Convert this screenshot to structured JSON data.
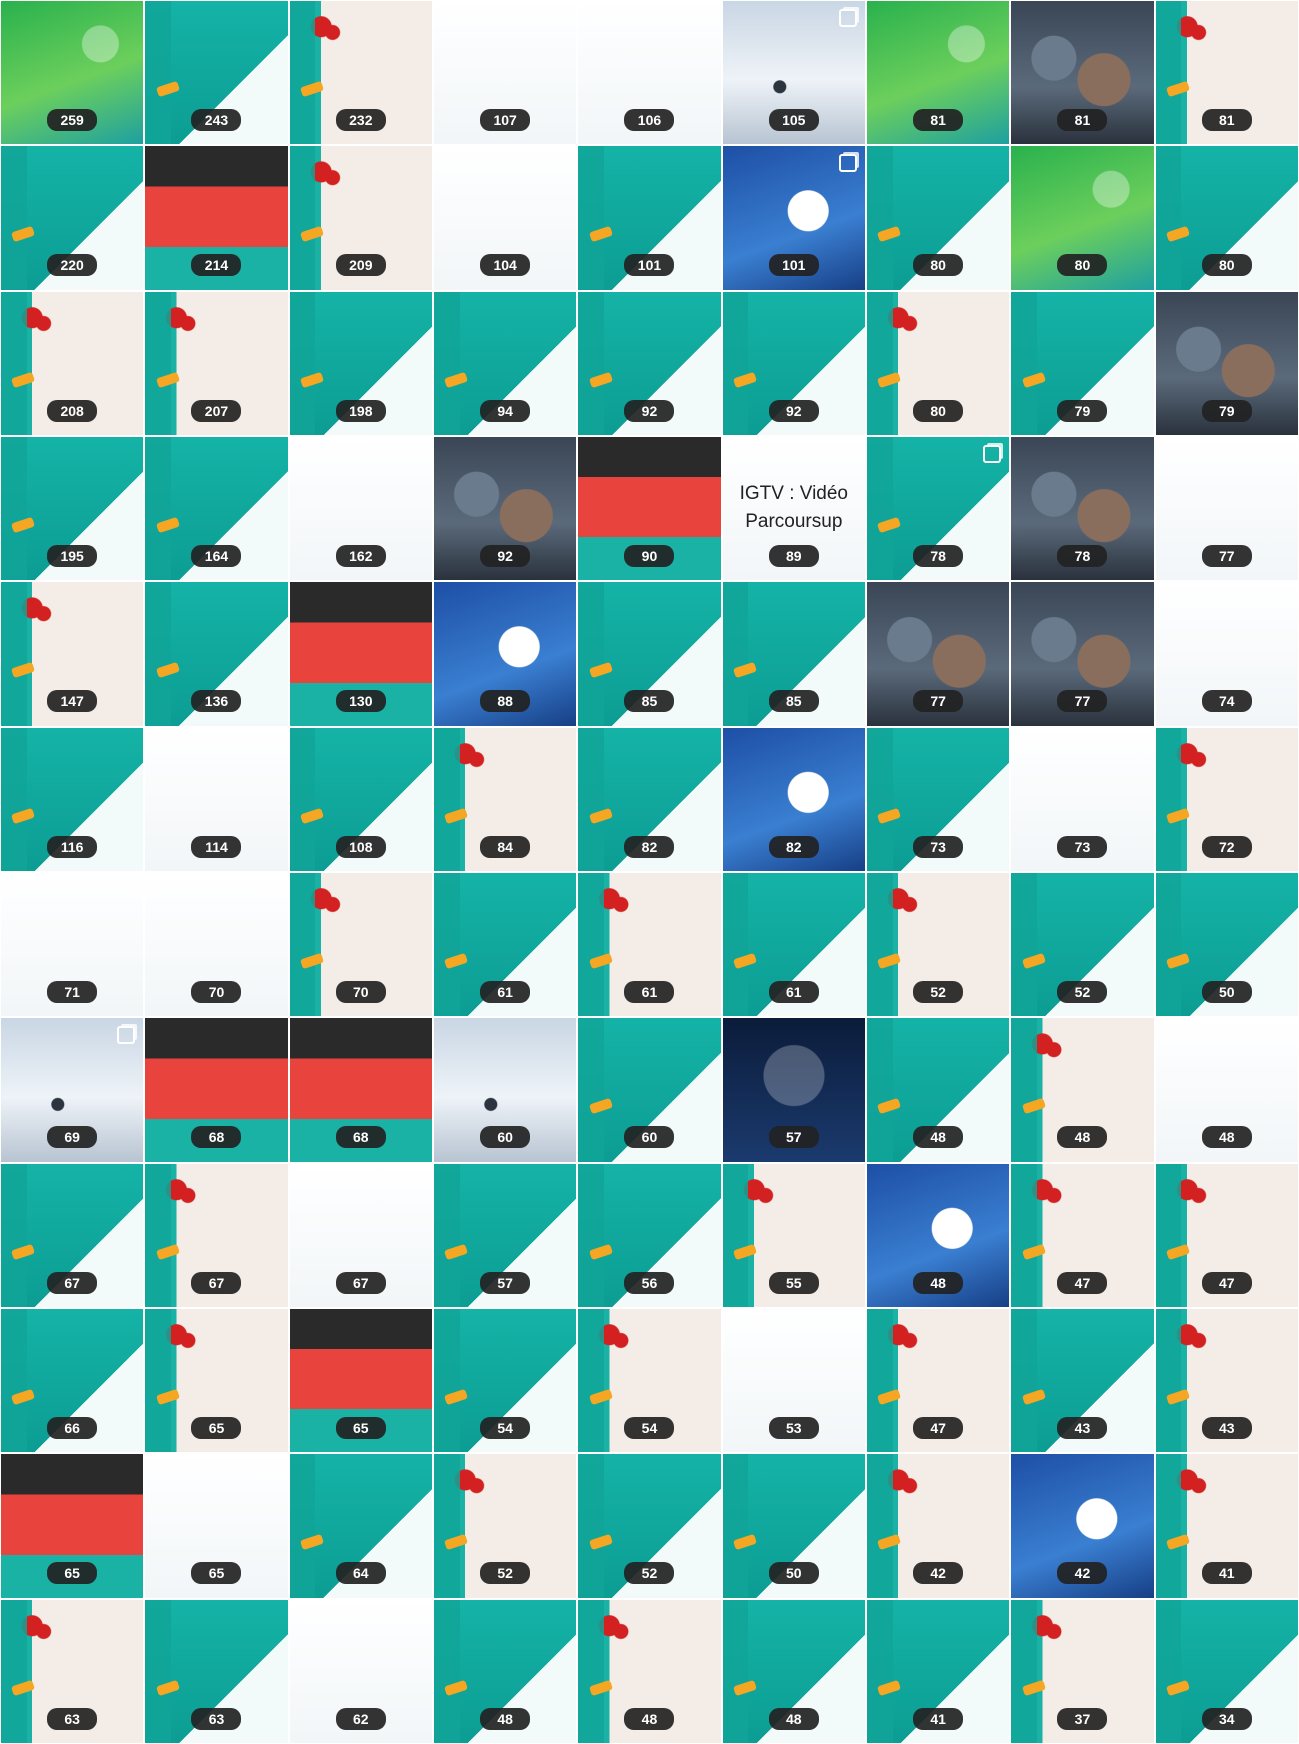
{
  "grid": {
    "columns": 9,
    "tiles": [
      {
        "count": "259",
        "style": "green"
      },
      {
        "count": "243",
        "style": "teal"
      },
      {
        "count": "232",
        "style": "xmas"
      },
      {
        "count": "107",
        "style": "white"
      },
      {
        "count": "106",
        "style": "white"
      },
      {
        "count": "105",
        "style": "snow"
      },
      {
        "count": "81",
        "style": "green"
      },
      {
        "count": "81",
        "style": "photo"
      },
      {
        "count": "81",
        "style": "xmas"
      },
      {
        "count": "220",
        "style": "teal"
      },
      {
        "count": "214",
        "style": "red"
      },
      {
        "count": "209",
        "style": "xmas"
      },
      {
        "count": "104",
        "style": "white"
      },
      {
        "count": "101",
        "style": "teal"
      },
      {
        "count": "101",
        "style": "blue"
      },
      {
        "count": "80",
        "style": "teal"
      },
      {
        "count": "80",
        "style": "green"
      },
      {
        "count": "80",
        "style": "teal"
      },
      {
        "count": "208",
        "style": "xmas"
      },
      {
        "count": "207",
        "style": "xmas"
      },
      {
        "count": "198",
        "style": "teal"
      },
      {
        "count": "94",
        "style": "teal"
      },
      {
        "count": "92",
        "style": "teal"
      },
      {
        "count": "92",
        "style": "teal"
      },
      {
        "count": "80",
        "style": "xmas"
      },
      {
        "count": "79",
        "style": "teal"
      },
      {
        "count": "79",
        "style": "photo"
      },
      {
        "count": "195",
        "style": "teal"
      },
      {
        "count": "164",
        "style": "teal"
      },
      {
        "count": "162",
        "style": "white"
      },
      {
        "count": "92",
        "style": "photo"
      },
      {
        "count": "90",
        "style": "red"
      },
      {
        "count": "89",
        "style": "white",
        "label": "IGTV : Vidéo\nParcoursup"
      },
      {
        "count": "78",
        "style": "teal"
      },
      {
        "count": "78",
        "style": "photo"
      },
      {
        "count": "77",
        "style": "white"
      },
      {
        "count": "147",
        "style": "xmas"
      },
      {
        "count": "136",
        "style": "teal"
      },
      {
        "count": "130",
        "style": "red"
      },
      {
        "count": "88",
        "style": "blue"
      },
      {
        "count": "85",
        "style": "teal"
      },
      {
        "count": "85",
        "style": "teal"
      },
      {
        "count": "77",
        "style": "photo"
      },
      {
        "count": "77",
        "style": "photo"
      },
      {
        "count": "74",
        "style": "white"
      },
      {
        "count": "116",
        "style": "teal"
      },
      {
        "count": "114",
        "style": "white"
      },
      {
        "count": "108",
        "style": "teal"
      },
      {
        "count": "84",
        "style": "xmas"
      },
      {
        "count": "82",
        "style": "teal"
      },
      {
        "count": "82",
        "style": "blue"
      },
      {
        "count": "73",
        "style": "teal"
      },
      {
        "count": "73",
        "style": "white"
      },
      {
        "count": "72",
        "style": "xmas"
      },
      {
        "count": "71",
        "style": "white"
      },
      {
        "count": "70",
        "style": "white"
      },
      {
        "count": "70",
        "style": "xmas"
      },
      {
        "count": "61",
        "style": "teal"
      },
      {
        "count": "61",
        "style": "xmas"
      },
      {
        "count": "61",
        "style": "teal"
      },
      {
        "count": "52",
        "style": "xmas"
      },
      {
        "count": "52",
        "style": "teal"
      },
      {
        "count": "50",
        "style": "teal"
      },
      {
        "count": "69",
        "style": "snow"
      },
      {
        "count": "68",
        "style": "red"
      },
      {
        "count": "68",
        "style": "red"
      },
      {
        "count": "60",
        "style": "snow"
      },
      {
        "count": "60",
        "style": "teal"
      },
      {
        "count": "57",
        "style": "dark"
      },
      {
        "count": "48",
        "style": "teal"
      },
      {
        "count": "48",
        "style": "xmas"
      },
      {
        "count": "48",
        "style": "white"
      },
      {
        "count": "67",
        "style": "teal"
      },
      {
        "count": "67",
        "style": "xmas"
      },
      {
        "count": "67",
        "style": "white"
      },
      {
        "count": "57",
        "style": "teal"
      },
      {
        "count": "56",
        "style": "teal"
      },
      {
        "count": "55",
        "style": "xmas"
      },
      {
        "count": "48",
        "style": "blue"
      },
      {
        "count": "47",
        "style": "xmas"
      },
      {
        "count": "47",
        "style": "xmas"
      },
      {
        "count": "66",
        "style": "teal"
      },
      {
        "count": "65",
        "style": "xmas"
      },
      {
        "count": "65",
        "style": "red"
      },
      {
        "count": "54",
        "style": "teal"
      },
      {
        "count": "54",
        "style": "xmas"
      },
      {
        "count": "53",
        "style": "white"
      },
      {
        "count": "47",
        "style": "xmas"
      },
      {
        "count": "43",
        "style": "teal"
      },
      {
        "count": "43",
        "style": "xmas"
      },
      {
        "count": "65",
        "style": "red"
      },
      {
        "count": "65",
        "style": "white"
      },
      {
        "count": "64",
        "style": "teal"
      },
      {
        "count": "52",
        "style": "xmas"
      },
      {
        "count": "52",
        "style": "teal"
      },
      {
        "count": "50",
        "style": "teal"
      },
      {
        "count": "42",
        "style": "xmas"
      },
      {
        "count": "42",
        "style": "blue"
      },
      {
        "count": "41",
        "style": "xmas"
      },
      {
        "count": "63",
        "style": "xmas"
      },
      {
        "count": "63",
        "style": "teal"
      },
      {
        "count": "62",
        "style": "white"
      },
      {
        "count": "48",
        "style": "teal"
      },
      {
        "count": "48",
        "style": "xmas"
      },
      {
        "count": "48",
        "style": "teal"
      },
      {
        "count": "41",
        "style": "teal"
      },
      {
        "count": "37",
        "style": "xmas"
      },
      {
        "count": "34",
        "style": "teal"
      }
    ]
  },
  "colors": {
    "brand_teal": "#15b3a7",
    "badge_bg": "#222222",
    "badge_text": "#ffffff",
    "accent_orange": "#f5a623",
    "accent_red": "#d32020"
  }
}
